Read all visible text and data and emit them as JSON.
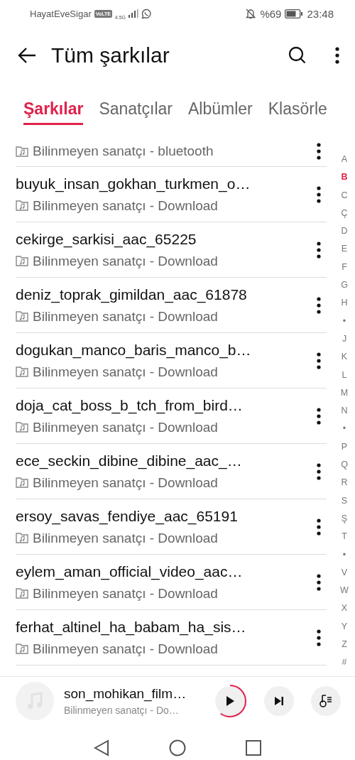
{
  "status_bar": {
    "carrier": "HayatEveSigar",
    "volte": "VoLTE",
    "network": "4.5G",
    "battery": "%69",
    "time": "23:48"
  },
  "header": {
    "title": "Tüm şarkılar"
  },
  "tabs": [
    {
      "label": "Şarkılar",
      "selected": true
    },
    {
      "label": "Sanatçılar",
      "selected": false
    },
    {
      "label": "Albümler",
      "selected": false
    },
    {
      "label": "Klasörle",
      "selected": false
    }
  ],
  "partial_row": {
    "subtitle": "Bilinmeyen sanatçı - bluetooth"
  },
  "songs": [
    {
      "title": "buyuk_insan_gokhan_turkmen_o…",
      "subtitle": "Bilinmeyen sanatçı - Download"
    },
    {
      "title": "cekirge_sarkisi_aac_65225",
      "subtitle": "Bilinmeyen sanatçı - Download"
    },
    {
      "title": "deniz_toprak_gimildan_aac_61878",
      "subtitle": "Bilinmeyen sanatçı - Download"
    },
    {
      "title": "dogukan_manco_baris_manco_b…",
      "subtitle": "Bilinmeyen sanatçı - Download"
    },
    {
      "title": "doja_cat_boss_b_tch_from_bird…",
      "subtitle": "Bilinmeyen sanatçı - Download"
    },
    {
      "title": "ece_seckin_dibine_dibine_aac_…",
      "subtitle": "Bilinmeyen sanatçı - Download"
    },
    {
      "title": "ersoy_savas_fendiye_aac_65191",
      "subtitle": "Bilinmeyen sanatçı - Download"
    },
    {
      "title": "eylem_aman_official_video_aac…",
      "subtitle": "Bilinmeyen sanatçı - Download"
    },
    {
      "title": "ferhat_altinel_ha_babam_ha_sis…",
      "subtitle": "Bilinmeyen sanatçı - Download"
    }
  ],
  "alphabet": [
    {
      "label": "A",
      "selected": false
    },
    {
      "label": "B",
      "selected": true
    },
    {
      "label": "C",
      "selected": false
    },
    {
      "label": "Ç",
      "selected": false
    },
    {
      "label": "D",
      "selected": false
    },
    {
      "label": "E",
      "selected": false
    },
    {
      "label": "F",
      "selected": false
    },
    {
      "label": "G",
      "selected": false
    },
    {
      "label": "H",
      "selected": false
    },
    {
      "label": "•",
      "selected": false
    },
    {
      "label": "J",
      "selected": false
    },
    {
      "label": "K",
      "selected": false
    },
    {
      "label": "L",
      "selected": false
    },
    {
      "label": "M",
      "selected": false
    },
    {
      "label": "N",
      "selected": false
    },
    {
      "label": "•",
      "selected": false
    },
    {
      "label": "P",
      "selected": false
    },
    {
      "label": "Q",
      "selected": false
    },
    {
      "label": "R",
      "selected": false
    },
    {
      "label": "S",
      "selected": false
    },
    {
      "label": "Ş",
      "selected": false
    },
    {
      "label": "T",
      "selected": false
    },
    {
      "label": "•",
      "selected": false
    },
    {
      "label": "V",
      "selected": false
    },
    {
      "label": "W",
      "selected": false
    },
    {
      "label": "X",
      "selected": false
    },
    {
      "label": "Y",
      "selected": false
    },
    {
      "label": "Z",
      "selected": false
    },
    {
      "label": "#",
      "selected": false
    }
  ],
  "player": {
    "title": "son_mohikan_film…",
    "subtitle": "Bilinmeyen sanatçı - Do…"
  }
}
